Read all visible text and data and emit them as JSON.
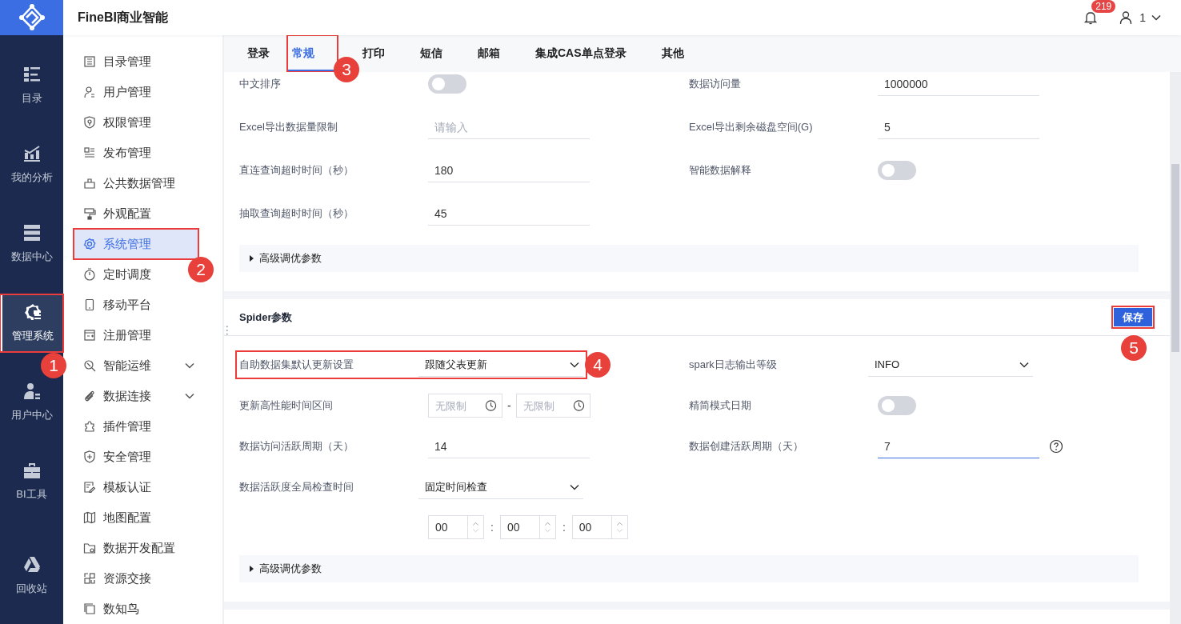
{
  "app": {
    "title": "FineBI商业智能",
    "notification_count": "219",
    "user": "1"
  },
  "rail": [
    {
      "label": "目录",
      "selected": false,
      "highlighted": false
    },
    {
      "label": "我的分析",
      "selected": false,
      "highlighted": false
    },
    {
      "label": "数据中心",
      "selected": false,
      "highlighted": false
    },
    {
      "label": "管理系统",
      "selected": true,
      "highlighted": true,
      "callout": "1"
    },
    {
      "label": "用户中心",
      "selected": false,
      "highlighted": false
    },
    {
      "label": "BI工具",
      "selected": false,
      "highlighted": false
    },
    {
      "label": "回收站",
      "selected": false,
      "highlighted": false
    }
  ],
  "menu": [
    {
      "label": "目录管理",
      "selected": false,
      "expandable": false,
      "highlighted": false
    },
    {
      "label": "用户管理",
      "selected": false,
      "expandable": false,
      "highlighted": false
    },
    {
      "label": "权限管理",
      "selected": false,
      "expandable": false,
      "highlighted": false
    },
    {
      "label": "发布管理",
      "selected": false,
      "expandable": false,
      "highlighted": false
    },
    {
      "label": "公共数据管理",
      "selected": false,
      "expandable": false,
      "highlighted": false
    },
    {
      "label": "外观配置",
      "selected": false,
      "expandable": false,
      "highlighted": false
    },
    {
      "label": "系统管理",
      "selected": true,
      "expandable": false,
      "highlighted": true,
      "callout": "2"
    },
    {
      "label": "定时调度",
      "selected": false,
      "expandable": false,
      "highlighted": false
    },
    {
      "label": "移动平台",
      "selected": false,
      "expandable": false,
      "highlighted": false
    },
    {
      "label": "注册管理",
      "selected": false,
      "expandable": false,
      "highlighted": false
    },
    {
      "label": "智能运维",
      "selected": false,
      "expandable": true,
      "highlighted": false
    },
    {
      "label": "数据连接",
      "selected": false,
      "expandable": true,
      "highlighted": false
    },
    {
      "label": "插件管理",
      "selected": false,
      "expandable": false,
      "highlighted": false
    },
    {
      "label": "安全管理",
      "selected": false,
      "expandable": false,
      "highlighted": false
    },
    {
      "label": "模板认证",
      "selected": false,
      "expandable": false,
      "highlighted": false
    },
    {
      "label": "地图配置",
      "selected": false,
      "expandable": false,
      "highlighted": false
    },
    {
      "label": "数据开发配置",
      "selected": false,
      "expandable": false,
      "highlighted": false
    },
    {
      "label": "资源交接",
      "selected": false,
      "expandable": false,
      "highlighted": false
    },
    {
      "label": "数知鸟",
      "selected": false,
      "expandable": false,
      "highlighted": false
    }
  ],
  "tabs": [
    {
      "label": "登录",
      "selected": false,
      "highlighted": false
    },
    {
      "label": "常规",
      "selected": true,
      "highlighted": true,
      "callout": "3"
    },
    {
      "label": "打印",
      "selected": false,
      "highlighted": false
    },
    {
      "label": "短信",
      "selected": false,
      "highlighted": false
    },
    {
      "label": "邮箱",
      "selected": false,
      "highlighted": false
    },
    {
      "label": "集成CAS单点登录",
      "selected": false,
      "highlighted": false
    },
    {
      "label": "其他",
      "selected": false,
      "highlighted": false
    }
  ],
  "panels": [
    {
      "fields": [
        {
          "kind": "toggle",
          "label": "中文排序",
          "on": false
        },
        {
          "kind": "text",
          "label": "数据访问量",
          "value": "1000000",
          "focused": false
        },
        {
          "kind": "text",
          "label": "Excel导出数据量限制",
          "placeholder": "请输入",
          "focused": false
        },
        {
          "kind": "text",
          "label": "Excel导出剩余磁盘空间(G)",
          "value": "5",
          "focused": false
        },
        {
          "kind": "text",
          "label": "直连查询超时时间（秒）",
          "value": "180",
          "focused": false
        },
        {
          "kind": "toggle",
          "label": "智能数据解释",
          "on": false
        },
        {
          "kind": "text",
          "label": "抽取查询超时时间（秒）",
          "value": "45",
          "focused": false
        }
      ],
      "advanced": {
        "label": "高级调优参数",
        "expanded": false
      }
    },
    {
      "title": "Spider参数",
      "save_button": {
        "label": "保存",
        "highlighted": true,
        "callout": "5"
      },
      "fields": [
        {
          "kind": "select",
          "label": "自助数据集默认更新设置",
          "value": "跟随父表更新",
          "highlighted": true,
          "callout": "4"
        },
        {
          "kind": "select",
          "label": "spark日志输出等级",
          "value": "INFO",
          "highlighted": false
        },
        {
          "kind": "time_range",
          "label": "更新高性能时间区间",
          "start": {
            "placeholder": "无限制"
          },
          "separator": "-",
          "end": {
            "placeholder": "无限制"
          }
        },
        {
          "kind": "toggle",
          "label": "精简模式日期",
          "on": false
        },
        {
          "kind": "text",
          "label": "数据访问活跃周期（天）",
          "value": "14",
          "focused": false
        },
        {
          "kind": "text",
          "label": "数据创建活跃周期（天）",
          "value": "7",
          "focused": true,
          "help": true
        },
        {
          "kind": "select",
          "label": "数据活跃度全局检查时间",
          "value": "固定时间检查",
          "highlighted": false,
          "time": {
            "values": [
              "00",
              "00",
              "00"
            ],
            "separator": ":"
          }
        }
      ],
      "advanced": {
        "label": "高级调优参数",
        "expanded": false
      }
    }
  ]
}
